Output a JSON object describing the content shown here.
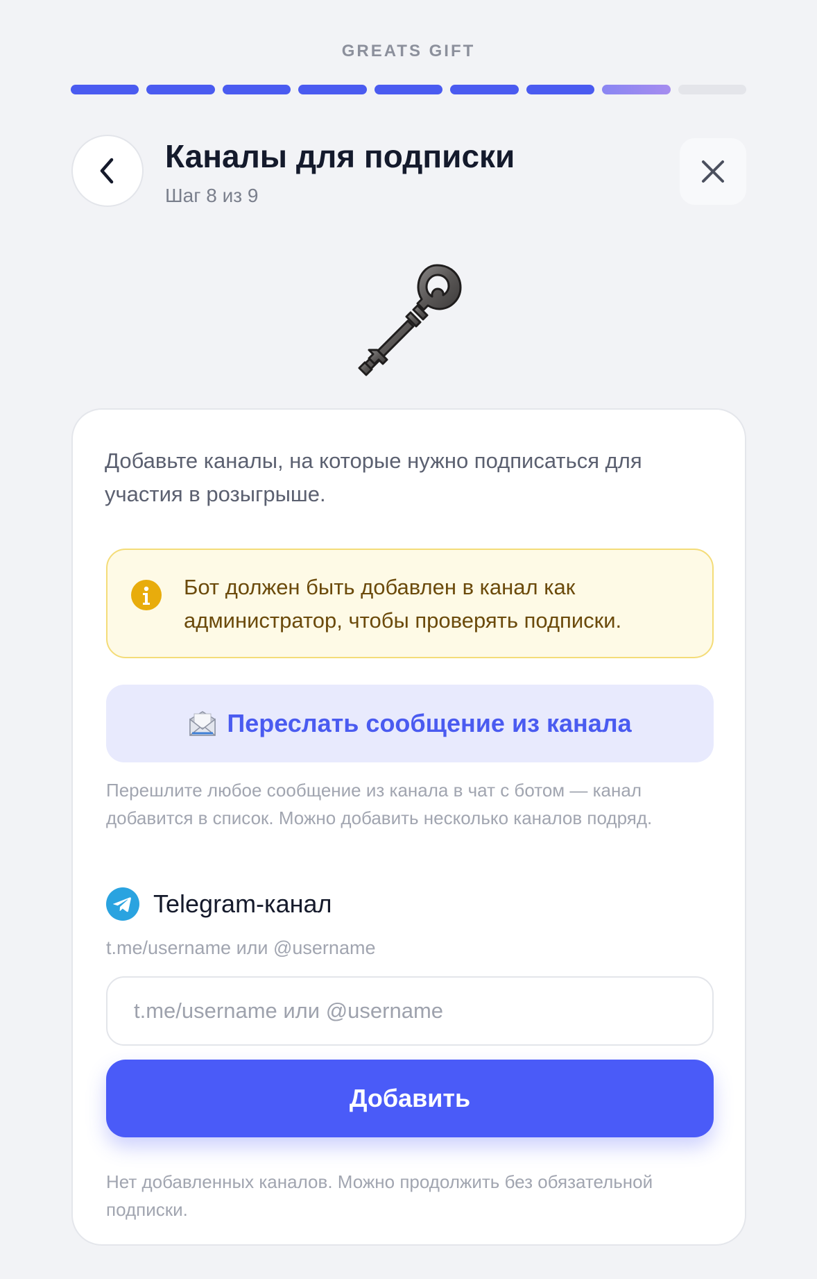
{
  "brand": "GREATS GIFT",
  "progress": {
    "total_steps": 9,
    "completed_steps": 7,
    "current_step": 8
  },
  "header": {
    "title": "Каналы для подписки",
    "subtitle": "Шаг 8 из 9",
    "back_icon": "chevron-left-icon",
    "close_icon": "close-icon"
  },
  "hero_icon": "key-icon",
  "card": {
    "intro": "Добавьте каналы, на которые нужно подписаться для участия в розыгрыше.",
    "alert": {
      "icon": "info-icon",
      "text": "Бот должен быть добавлен в канал как администратор, чтобы проверять подписки."
    },
    "forward_button": {
      "icon": "envelope-icon",
      "label": "Переслать сообщение из канала"
    },
    "forward_hint": "Перешлите любое сообщение из канала в чат с ботом — канал добавится в список. Можно добавить несколько каналов подряд.",
    "telegram": {
      "icon": "telegram-icon",
      "label": "Telegram-канал",
      "caption": "t.me/username или @username",
      "placeholder": "t.me/username или @username",
      "value": ""
    },
    "add_button": "Добавить",
    "empty_note": "Нет добавленных каналов. Можно продолжить без обязательной подписки."
  },
  "colors": {
    "accent": "#4a5bf8",
    "progress_done": "#4a5bf0",
    "progress_current": "#a58cef",
    "alert_bg": "#fefae6",
    "alert_border": "#f4dc78",
    "telegram": "#2aa3e0"
  }
}
